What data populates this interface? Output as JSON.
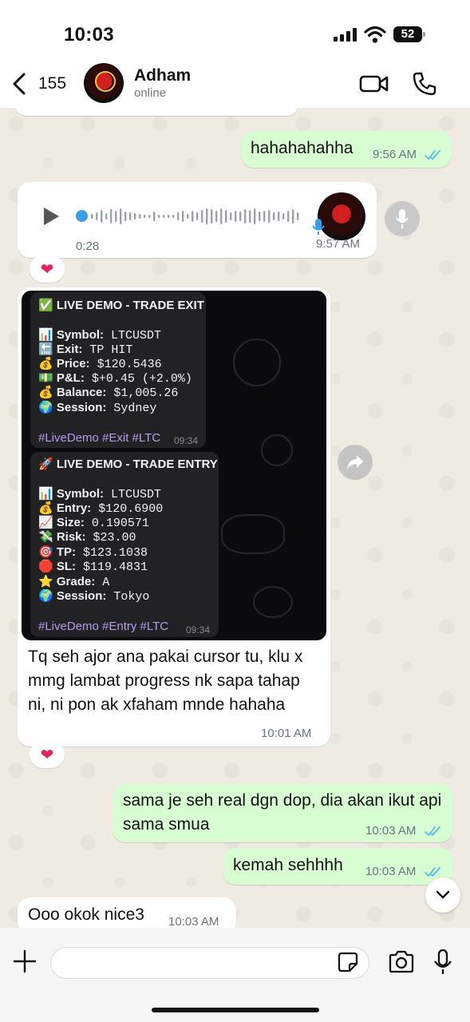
{
  "status_bar": {
    "time": "10:03",
    "battery": "52"
  },
  "header": {
    "back_count": "155",
    "contact_name": "Adham",
    "contact_status": "online"
  },
  "messages": {
    "m1_text": "hahahahahha",
    "m1_time": "9:56 AM",
    "voice_duration": "0:28",
    "voice_time": "9:57 AM",
    "m3_text": "Tq seh ajor ana pakai cursor tu, klu x mmg lambat progress nk sapa tahap ni, ni pon ak xfaham mnde hahaha",
    "m3_time": "10:01 AM",
    "m4_text": "sama je seh real dgn dop, dia akan ikut api sama smua",
    "m4_time": "10:03 AM",
    "m5_text": "kemah sehhhh",
    "m5_time": "10:03 AM",
    "m6_text": "Ooo okok nice3",
    "m6_time": "10:03 AM",
    "reaction": "❤"
  },
  "card_exit": {
    "title": "✅ LIVE DEMO - TRADE EXIT",
    "symbol_label": "📊 Symbol:",
    "symbol": "LTCUSDT",
    "exit_label": "🔚 Exit:",
    "exit": "TP HIT",
    "price_label": "💰 Price:",
    "price": "$120.5436",
    "pnl_label": "💵 P&L:",
    "pnl": "$+0.45 (+2.0%)",
    "balance_label": "💰 Balance:",
    "balance": "$1,005.26",
    "session_label": "🌍 Session:",
    "session": "Sydney",
    "tags": "#LiveDemo #Exit #LTC",
    "time": "09:34"
  },
  "card_entry": {
    "title": "🚀 LIVE DEMO - TRADE ENTRY",
    "symbol_label": "📊 Symbol:",
    "symbol": "LTCUSDT",
    "entry_label": "💰 Entry:",
    "entry": "$120.6900",
    "size_label": "📈 Size:",
    "size": "0.190571",
    "risk_label": "💸 Risk:",
    "risk": "$23.00",
    "tp_label": "🎯 TP:",
    "tp": "$123.1038",
    "sl_label": "🛑 SL:",
    "sl": "$119.4831",
    "grade_label": "⭐ Grade:",
    "grade": "A",
    "session_label": "🌍 Session:",
    "session": "Tokyo",
    "tags": "#LiveDemo #Entry #LTC",
    "time": "09:34"
  },
  "icons": [
    "back-chevron-icon",
    "video-call-icon",
    "phone-call-icon",
    "play-icon",
    "microphone-icon",
    "share-forward-icon",
    "chevron-down-icon",
    "plus-icon",
    "sticker-icon",
    "camera-icon"
  ],
  "colors": {
    "outgoing_bubble": "#d9fdd3",
    "incoming_bubble": "#ffffff",
    "read_ticks": "#53bdeb",
    "chat_bg": "#efeae2"
  }
}
